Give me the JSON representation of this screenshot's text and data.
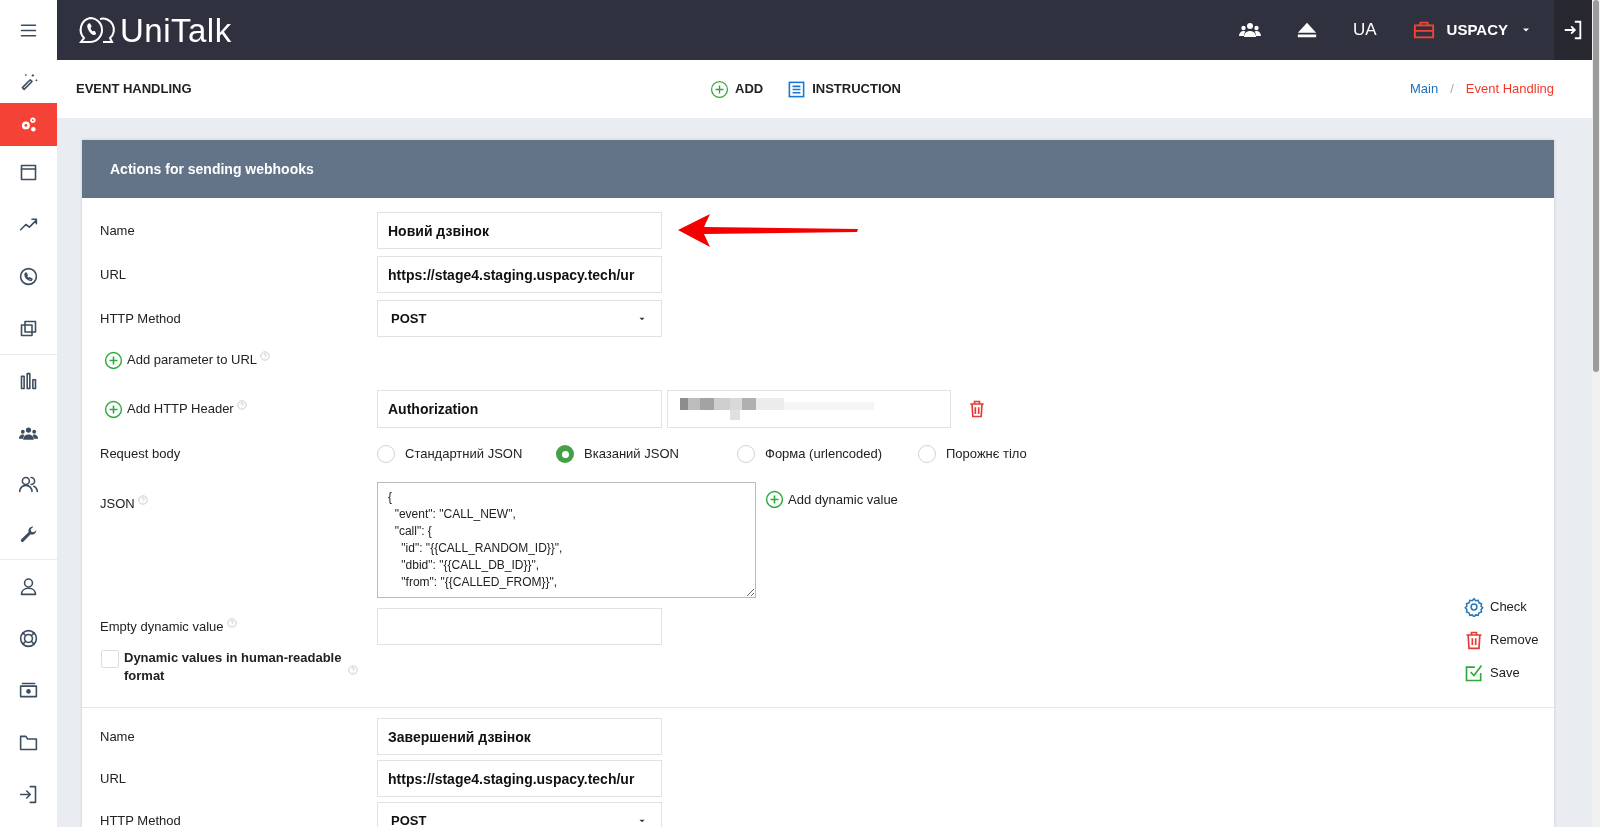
{
  "sidebar": {
    "items": [
      {
        "selected": false
      },
      {
        "selected": false
      },
      {
        "selected": true
      },
      {
        "selected": false
      },
      {
        "selected": false
      },
      {
        "selected": false
      },
      {
        "selected": false
      },
      {
        "selected": false
      },
      {
        "selected": false
      },
      {
        "selected": false
      },
      {
        "selected": false
      },
      {
        "selected": false
      },
      {
        "selected": false
      },
      {
        "selected": false
      },
      {
        "selected": false
      },
      {
        "selected": false
      }
    ]
  },
  "top_bar": {
    "logo": "UniTalk",
    "language": "UA",
    "company": "USPACY"
  },
  "page_header": {
    "title": "EVENT HANDLING",
    "actions": [
      {
        "kind": "add",
        "label": "ADD"
      },
      {
        "kind": "instruction",
        "label": "INSTRUCTION"
      }
    ],
    "breadcrumbs": [
      {
        "label": "Main",
        "selected": false
      },
      {
        "label": "Event Handling",
        "selected": true
      }
    ],
    "separator": "/"
  },
  "card": {
    "title": "Actions for sending webhooks",
    "webhooks": [
      {
        "fields": [
          {
            "kind": "text",
            "label": "Name",
            "value": "Новий дзвінок"
          },
          {
            "kind": "text",
            "label": "URL",
            "value": "https://stage4.staging.uspacy.tech/ur"
          },
          {
            "kind": "select",
            "label": "HTTP Method",
            "value": "POST"
          },
          {
            "kind": "add",
            "label": "Add parameter to URL",
            "help": true
          },
          {
            "kind": "header",
            "label": "Add HTTP Header",
            "help": true,
            "value": "Authorization"
          },
          {
            "kind": "radio",
            "label": "Request body",
            "options": [
              {
                "label": "Стандартний JSON",
                "selected": false
              },
              {
                "label": "Вказаний JSON",
                "selected": true
              },
              {
                "label": "Форма (urlencoded)",
                "selected": false
              },
              {
                "label": "Порожнє тіло",
                "selected": false
              }
            ]
          },
          {
            "kind": "textarea",
            "label": "JSON",
            "help": true,
            "lines": [
              "{",
              "  \"event\": \"CALL_NEW\",",
              "  \"call\": {",
              "    \"id\": \"{{CALL_RANDOM_ID}}\",",
              "    \"dbid\": \"{{CALL_DB_ID}}\",",
              "    \"from\": \"{{CALLED_FROM}}\","
            ],
            "action": "Add dynamic value"
          },
          {
            "kind": "text",
            "label": "Empty dynamic value",
            "help": true
          },
          {
            "kind": "checkbox",
            "label": "Dynamic values in human-readable format",
            "help": true,
            "checked": false
          }
        ],
        "actions": [
          {
            "kind": "check",
            "label": "Check"
          },
          {
            "kind": "remove",
            "label": "Remove"
          },
          {
            "kind": "save",
            "label": "Save"
          }
        ]
      },
      {
        "fields": [
          {
            "kind": "text",
            "label": "Name",
            "value": "Завершений дзвінок"
          },
          {
            "kind": "text",
            "label": "URL",
            "value": "https://stage4.staging.uspacy.tech/ur"
          },
          {
            "kind": "select",
            "label": "HTTP Method",
            "value": "POST"
          }
        ]
      }
    ]
  }
}
